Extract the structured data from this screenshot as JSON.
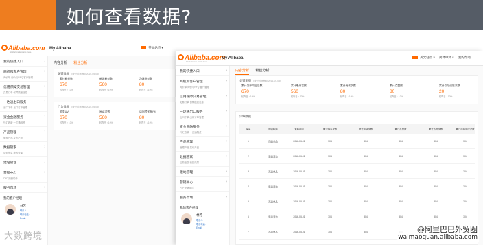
{
  "slide": {
    "title": "如何查看数据?",
    "accent_color": "#ee7d1f",
    "banner_color": "#555c66"
  },
  "header": {
    "logo_text": "Alibaba.com",
    "logo_tagline": "Global trade starts here.",
    "product": "My Alibaba",
    "account": "英文站点 ▾",
    "language": "简体中文 ▾",
    "help": "我的帮助"
  },
  "sidebar": {
    "items": [
      {
        "title": "我的快捷入口",
        "sub": ""
      },
      {
        "title": "商机和客户管理",
        "sub": "询价单  询价与RFQ  客户管理"
      },
      {
        "title": "信用保障交易管理",
        "sub": "交易订单  保障额度信息"
      },
      {
        "title": "一达通出口服务",
        "sub": "出口下单  出口订单管理"
      },
      {
        "title": "资金金融服务",
        "sub": "外汇收款  一达通融资"
      },
      {
        "title": "产品管理",
        "sub": "管理产品  发布产品"
      },
      {
        "title": "数据管家",
        "sub": "后勤信息  我的效果"
      },
      {
        "title": "建站管理",
        "sub": ""
      },
      {
        "title": "营销中心",
        "sub": "P4P  拓客助手"
      },
      {
        "title": "服务市场",
        "sub": ""
      }
    ],
    "manager_title": "我的客户经理",
    "manager_name": "林芳",
    "manager_lines": [
      "联系人 ",
      "联系电话:",
      "Email:"
    ]
  },
  "tabs": [
    "内容分析",
    "粉丝分析"
  ],
  "overview": {
    "title": "关键洞察",
    "date_note": "(统计时间截至2016-05-03)",
    "metrics": [
      {
        "label": "累计发布内容总数",
        "value": "670",
        "change": "较昨日 ↑ 10%"
      },
      {
        "label": "累计曝光次数",
        "value": "560",
        "change": "较昨日 ↑ 10%"
      },
      {
        "label": "累计阅读次数",
        "value": "80",
        "change": "较昨日 ↓ 10%"
      },
      {
        "label": "累计点赞数",
        "value": "80",
        "change": "较昨日 ↓ 10%"
      },
      {
        "label": "累计引导进店次数",
        "value": "20",
        "change": "较昨日 ↑ 10%"
      }
    ]
  },
  "left_overview": {
    "title": "关键数据",
    "date_note": "(统计时间截至2016-05-03)",
    "metrics": [
      {
        "label": "累计粉丝数",
        "value": "670",
        "change": "较昨日 ↑ 10%"
      },
      {
        "label": "新增粉丝数",
        "value": "560",
        "change": "较昨日 ↑ 10%"
      },
      {
        "label": "净增粉丝数",
        "value": "80",
        "change": "较昨日 ↓ 10%"
      }
    ],
    "behavior_title": "行为数据",
    "behavior_metrics": [
      {
        "label": "浏览UV",
        "value": "670",
        "change": "较昨日 ↑ 10%"
      },
      {
        "label": "阅读次数",
        "value": "560",
        "change": "较昨日 ↑ 10%"
      },
      {
        "label": "访问转化率(%)",
        "value": "80",
        "change": "较昨日 ↓ 10%"
      }
    ]
  },
  "detail": {
    "title": "详细数据",
    "columns": [
      "序号",
      "内容标题",
      "发布时间",
      "累计曝光次数",
      "累计阅读次数",
      "累计点赞数",
      "累计点赞次数",
      "累计引导进店次数"
    ],
    "rows": [
      [
        "1",
        "商品单品",
        "2016-03-01",
        "304",
        "304",
        "304",
        "304",
        "304"
      ],
      [
        "2",
        "新品活动",
        "2016-03-01",
        "304",
        "304",
        "304",
        "304",
        "304"
      ],
      [
        "3",
        "商品单品",
        "2016-03-01",
        "304",
        "304",
        "304",
        "304",
        "304"
      ],
      [
        "4",
        "新品活动",
        "2016-03-01",
        "304",
        "304",
        "304",
        "304",
        "304"
      ],
      [
        "5",
        "商品单品",
        "2016-03-01",
        "304",
        "304",
        "304",
        "304",
        "304"
      ],
      [
        "6",
        "新品活动",
        "2016-03-01",
        "304",
        "304",
        "304",
        "304",
        "304"
      ],
      [
        "7",
        "商品单品",
        "2016-03-01",
        "304",
        "304",
        "304",
        "304",
        "304"
      ]
    ]
  },
  "watermark": {
    "left": "大数跨境",
    "right_line1": "@阿里巴巴外贸圈",
    "right_line2": "waimaoquan.alibaba.com"
  }
}
